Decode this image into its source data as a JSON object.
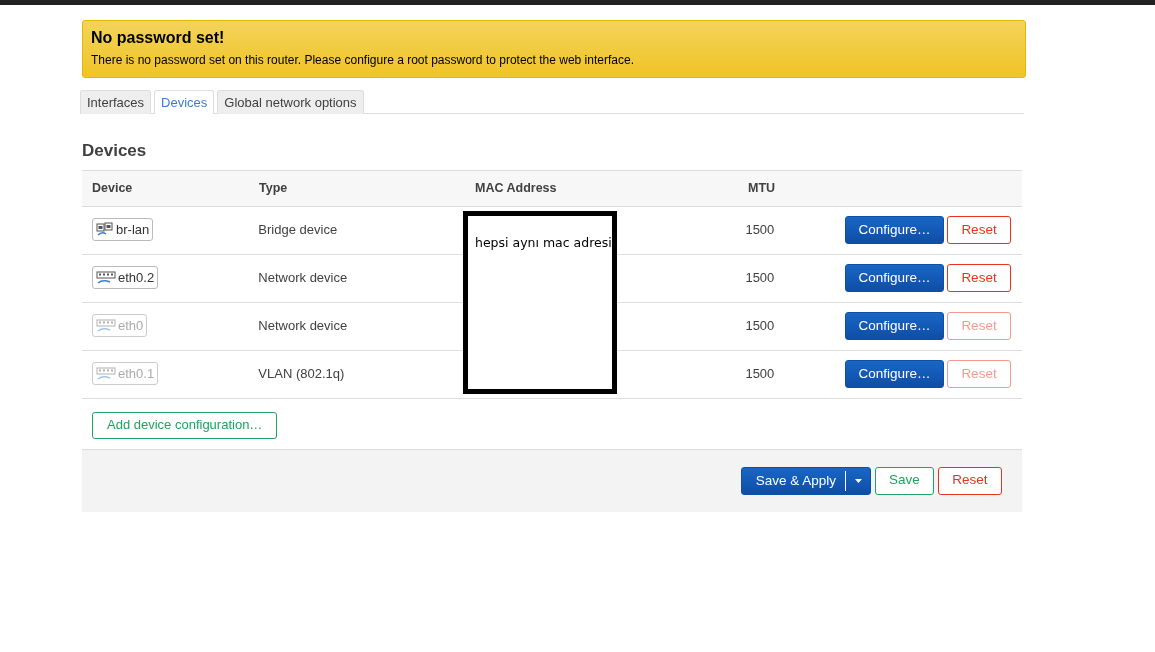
{
  "alert": {
    "title": "No password set!",
    "message": "There is no password set on this router. Please configure a root password to protect the web interface."
  },
  "tabs": [
    {
      "label": "Interfaces",
      "selected": false
    },
    {
      "label": "Devices",
      "selected": true
    },
    {
      "label": "Global network options",
      "selected": false
    }
  ],
  "section_title": "Devices",
  "table": {
    "columns": [
      "Device",
      "Type",
      "MAC Address",
      "MTU"
    ],
    "rows": [
      {
        "device": "br-lan",
        "kind": "bridge",
        "active": true,
        "type": "Bridge device",
        "mtu": "1500",
        "configure": "Configure…",
        "reset": {
          "label": "Reset",
          "disabled": false
        }
      },
      {
        "device": "eth0.2",
        "kind": "ethernet",
        "active": true,
        "type": "Network device",
        "mtu": "1500",
        "configure": "Configure…",
        "reset": {
          "label": "Reset",
          "disabled": false
        }
      },
      {
        "device": "eth0",
        "kind": "ethernet",
        "active": false,
        "type": "Network device",
        "mtu": "1500",
        "configure": "Configure…",
        "reset": {
          "label": "Reset",
          "disabled": true
        }
      },
      {
        "device": "eth0.1",
        "kind": "ethernet",
        "active": false,
        "type": "VLAN (802.1q)",
        "mtu": "1500",
        "configure": "Configure…",
        "reset": {
          "label": "Reset",
          "disabled": true
        }
      }
    ]
  },
  "overlay_note": "hepsi aynı mac adresi",
  "add_button": "Add device configuration…",
  "footer": {
    "save_apply": "Save & Apply",
    "save": "Save",
    "reset": "Reset"
  }
}
